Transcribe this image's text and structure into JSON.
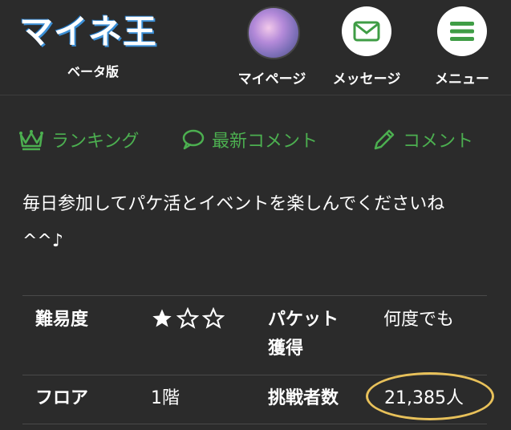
{
  "header": {
    "logo_title": "マイネ王",
    "logo_subtitle": "ベータ版",
    "buttons": [
      {
        "label": "マイページ",
        "icon": "avatar"
      },
      {
        "label": "メッセージ",
        "icon": "envelope-icon"
      },
      {
        "label": "メニュー",
        "icon": "hamburger-menu-icon"
      }
    ]
  },
  "nav": {
    "items": [
      {
        "label": "ランキング",
        "icon": "crown-icon"
      },
      {
        "label": "最新コメント",
        "icon": "speech-bubble-icon"
      },
      {
        "label": "コメント",
        "icon": "pencil-icon"
      }
    ]
  },
  "description": {
    "line1": "毎日参加してパケ活とイベントを楽しんでくださいね",
    "line2": "^^♪"
  },
  "table": {
    "difficulty_label": "難易度",
    "difficulty_rating": {
      "filled": 1,
      "total": 3
    },
    "packet_label_1": "パケット",
    "packet_label_2": "獲得",
    "packet_value": "何度でも",
    "floor_label": "フロア",
    "floor_value": "1階",
    "challengers_label": "挑戦者数",
    "challengers_value": "21,385人"
  },
  "colors": {
    "background": "#2b2b2b",
    "accent_green": "#4caf50",
    "highlight_yellow": "#e8c15a"
  }
}
